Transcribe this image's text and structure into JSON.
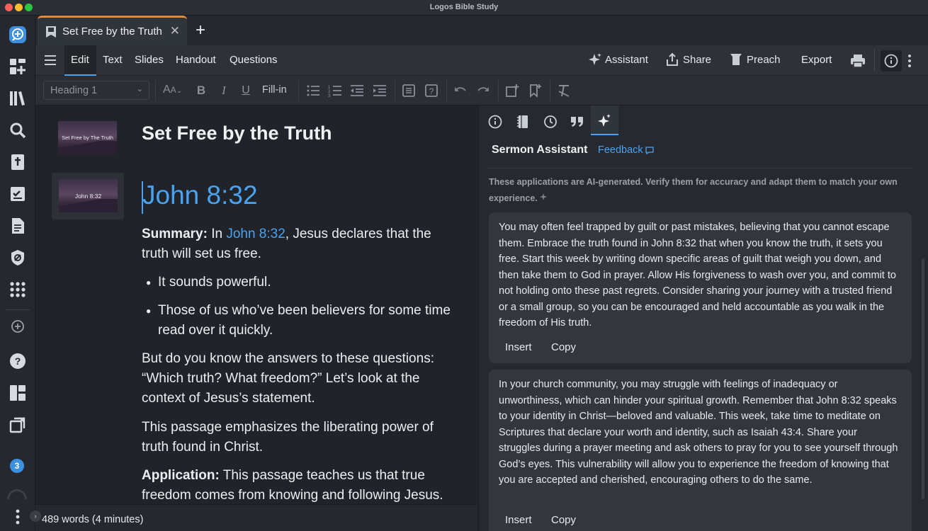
{
  "app": {
    "title": "Logos Bible Study"
  },
  "colors": {
    "accent": "#4aa3f0",
    "tab_accent": "#e08a3c",
    "background": "#202329",
    "panel": "#26292f"
  },
  "rail": {
    "icons": [
      "logos-home-icon",
      "dashboard-add-icon",
      "library-icon",
      "search-icon",
      "bible-icon",
      "checklist-icon",
      "document-icon",
      "shield-icon",
      "apps-grid-icon",
      "add-circle-icon",
      "help-icon",
      "layout-icon",
      "close-windows-icon",
      "notifications-badge-icon",
      "more-icon"
    ],
    "badge_count": "3"
  },
  "tabs": {
    "doc_tab_label": "Set Free by the Truth",
    "new_tab": "+"
  },
  "menubar": {
    "items": [
      "Edit",
      "Text",
      "Slides",
      "Handout",
      "Questions"
    ],
    "assistant": "Assistant",
    "share": "Share",
    "preach": "Preach",
    "export": "Export"
  },
  "format": {
    "style_select": "Heading 1",
    "fill_in": "Fill-in"
  },
  "editor": {
    "title_slide_text": "Set Free by The Truth",
    "doc_title": "Set Free by the Truth",
    "verse_slide_text": "John 8:32",
    "heading": "John 8:32",
    "summary_label": "Summary:",
    "summary_pre": " In ",
    "summary_link": "John 8:32",
    "summary_post": ", Jesus declares that the truth will set us free.",
    "bullets": [
      "It sounds powerful.",
      "Those of us who’ve been believers for some time read over it quickly."
    ],
    "para1": "But do you know the answers to these questions: “Which truth? What freedom?” Let’s look at the context of Jesus’s statement.",
    "para2": "This passage emphasizes the liberating power of truth found in Christ.",
    "application_label": "Application:",
    "application_text": " This passage teaches us that true freedom comes from knowing and following Jesus."
  },
  "status": {
    "word_count": "489 words (4 minutes)"
  },
  "panel": {
    "title": "Sermon Assistant",
    "feedback": "Feedback",
    "disclaimer": "These applications are AI-generated. Verify them for accuracy and adapt them to match your own experience.",
    "cards": [
      {
        "text": "You may often feel trapped by guilt or past mistakes, believing that you cannot escape them. Embrace the truth found in John 8:32 that when you know the truth, it sets you free. Start this week by writing down specific areas of guilt that weigh you down, and then take them to God in prayer. Allow His forgiveness to wash over you, and commit to not holding onto these past regrets. Consider sharing your journey with a trusted friend or a small group, so you can be encouraged and held accountable as you walk in the freedom of His truth.",
        "insert": "Insert",
        "copy": "Copy"
      },
      {
        "text": "In your church community, you may struggle with feelings of inadequacy or unworthiness, which can hinder your spiritual growth. Remember that John 8:32 speaks to your identity in Christ—beloved and valuable. This week, take time to meditate on Scriptures that declare your worth and identity, such as Isaiah 43:4. Share your struggles during a prayer meeting and ask others to pray for you to see yourself through God’s eyes. This vulnerability will allow you to experience the freedom of knowing that you are accepted and cherished, encouraging others to do the same.",
        "insert": "Insert",
        "copy": "Copy"
      }
    ]
  }
}
